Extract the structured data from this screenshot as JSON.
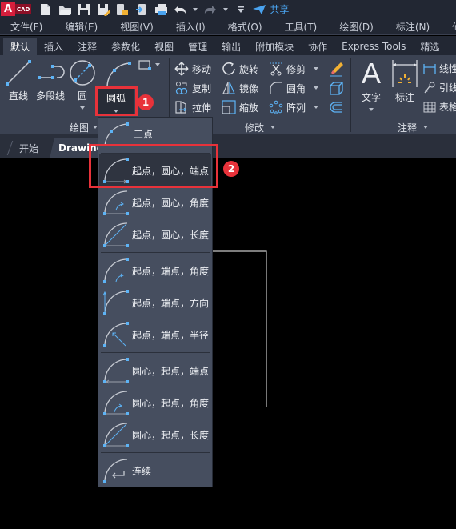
{
  "app": {
    "logo_letter": "A",
    "logo_text": "CAD",
    "share_label": "共享",
    "quick_access": [
      "new-file-icon",
      "open-folder-icon",
      "save-icon",
      "save-as-icon",
      "open-from-device-icon",
      "send-to-device-icon",
      "print-icon",
      "undo-icon",
      "redo-icon",
      "customize-qat-icon"
    ]
  },
  "menubar": {
    "items": [
      "文件(F)",
      "编辑(E)",
      "视图(V)",
      "插入(I)",
      "格式(O)",
      "工具(T)",
      "绘图(D)",
      "标注(N)",
      "修改(M)"
    ]
  },
  "ribbon_tabs": {
    "items": [
      "默认",
      "插入",
      "注释",
      "参数化",
      "视图",
      "管理",
      "输出",
      "附加模块",
      "协作",
      "Express Tools",
      "精选"
    ],
    "active": "默认"
  },
  "ribbon": {
    "draw_group": {
      "label": "绘图",
      "line": "直线",
      "polyline": "多段线",
      "circle": "圆",
      "arc": "圆弧"
    },
    "modify_group": {
      "label": "修改",
      "move": "移动",
      "rotate": "旋转",
      "trim": "修剪",
      "copy": "复制",
      "mirror": "镜像",
      "fillet": "圆角",
      "stretch": "拉伸",
      "scale": "缩放",
      "array": "阵列"
    },
    "annotation_group": {
      "label": "注释",
      "text": "文字",
      "dimension": "标注",
      "linear": "线性",
      "leader": "引线",
      "table": "表格"
    }
  },
  "doc_tabs": {
    "start": "开始",
    "drawing": "Drawing"
  },
  "arc_dropdown": {
    "items": [
      {
        "label": "三点",
        "icon": "arc-three-point-icon"
      },
      {
        "label": "起点，圆心，端点",
        "icon": "arc-start-center-end-icon",
        "highlighted": true
      },
      {
        "label": "起点，圆心，角度",
        "icon": "arc-start-center-angle-icon"
      },
      {
        "label": "起点，圆心，长度",
        "icon": "arc-start-center-length-icon"
      },
      {
        "label": "起点，端点，角度",
        "icon": "arc-start-end-angle-icon"
      },
      {
        "label": "起点，端点，方向",
        "icon": "arc-start-end-direction-icon"
      },
      {
        "label": "起点，端点，半径",
        "icon": "arc-start-end-radius-icon"
      },
      {
        "label": "圆心，起点，端点",
        "icon": "arc-center-start-end-icon"
      },
      {
        "label": "圆心，起点，角度",
        "icon": "arc-center-start-angle-icon"
      },
      {
        "label": "圆心，起点，长度",
        "icon": "arc-center-start-length-icon"
      },
      {
        "label": "连续",
        "icon": "arc-continue-icon"
      }
    ]
  },
  "annotations": {
    "badge1": "1",
    "badge2": "2"
  },
  "colors": {
    "accent_blue": "#4aa3ef",
    "callout_red": "#e8323a",
    "logo_red": "#d51f3c",
    "ribbon_bg": "#3b4252",
    "dropdown_bg": "#464e5f"
  }
}
